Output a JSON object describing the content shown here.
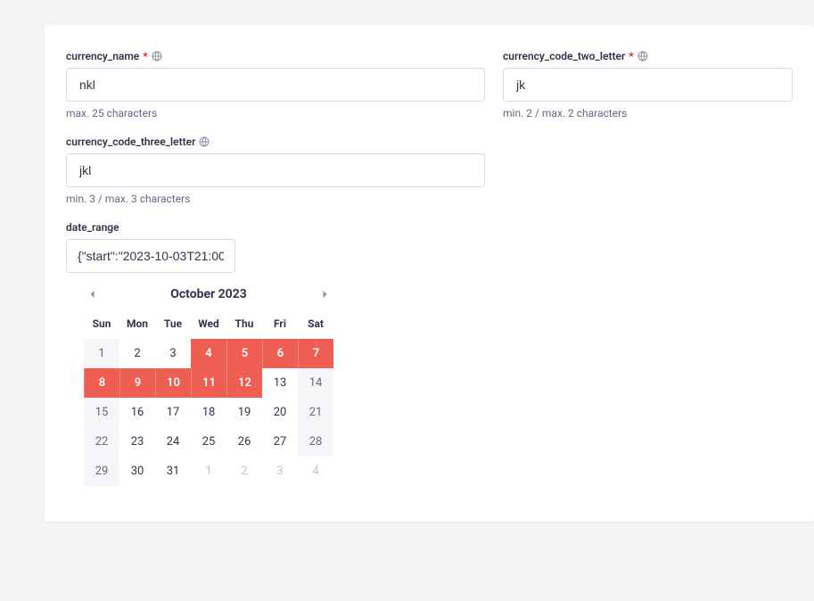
{
  "fields": {
    "currency_name": {
      "label": "currency_name",
      "required": true,
      "i18n": true,
      "value": "nkl",
      "help": "max. 25 characters"
    },
    "currency_code_two_letter": {
      "label": "currency_code_two_letter",
      "required": true,
      "i18n": true,
      "value": "jk",
      "help": "min. 2 / max. 2 characters"
    },
    "currency_code_three_letter": {
      "label": "currency_code_three_letter",
      "required": false,
      "i18n": true,
      "value": "jkl",
      "help": "min. 3 / max. 3 characters"
    },
    "date_range": {
      "label": "date_range",
      "value": "{\"start\":\"2023-10-03T21:00"
    }
  },
  "calendar": {
    "title": "October 2023",
    "dow": [
      "Sun",
      "Mon",
      "Tue",
      "Wed",
      "Thu",
      "Fri",
      "Sat"
    ],
    "days": [
      {
        "n": 1,
        "cls": "muted"
      },
      {
        "n": 2,
        "cls": ""
      },
      {
        "n": 3,
        "cls": ""
      },
      {
        "n": 4,
        "cls": "sel"
      },
      {
        "n": 5,
        "cls": "sel"
      },
      {
        "n": 6,
        "cls": "sel"
      },
      {
        "n": 7,
        "cls": "sel"
      },
      {
        "n": 8,
        "cls": "sel"
      },
      {
        "n": 9,
        "cls": "sel"
      },
      {
        "n": 10,
        "cls": "sel"
      },
      {
        "n": 11,
        "cls": "sel"
      },
      {
        "n": 12,
        "cls": "sel"
      },
      {
        "n": 13,
        "cls": ""
      },
      {
        "n": 14,
        "cls": "muted"
      },
      {
        "n": 15,
        "cls": "muted"
      },
      {
        "n": 16,
        "cls": ""
      },
      {
        "n": 17,
        "cls": ""
      },
      {
        "n": 18,
        "cls": ""
      },
      {
        "n": 19,
        "cls": ""
      },
      {
        "n": 20,
        "cls": ""
      },
      {
        "n": 21,
        "cls": "muted"
      },
      {
        "n": 22,
        "cls": "muted"
      },
      {
        "n": 23,
        "cls": ""
      },
      {
        "n": 24,
        "cls": ""
      },
      {
        "n": 25,
        "cls": ""
      },
      {
        "n": 26,
        "cls": ""
      },
      {
        "n": 27,
        "cls": ""
      },
      {
        "n": 28,
        "cls": "muted"
      },
      {
        "n": 29,
        "cls": "muted"
      },
      {
        "n": 30,
        "cls": ""
      },
      {
        "n": 31,
        "cls": ""
      },
      {
        "n": 1,
        "cls": "dim"
      },
      {
        "n": 2,
        "cls": "dim"
      },
      {
        "n": 3,
        "cls": "dim"
      },
      {
        "n": 4,
        "cls": "dim"
      }
    ]
  }
}
